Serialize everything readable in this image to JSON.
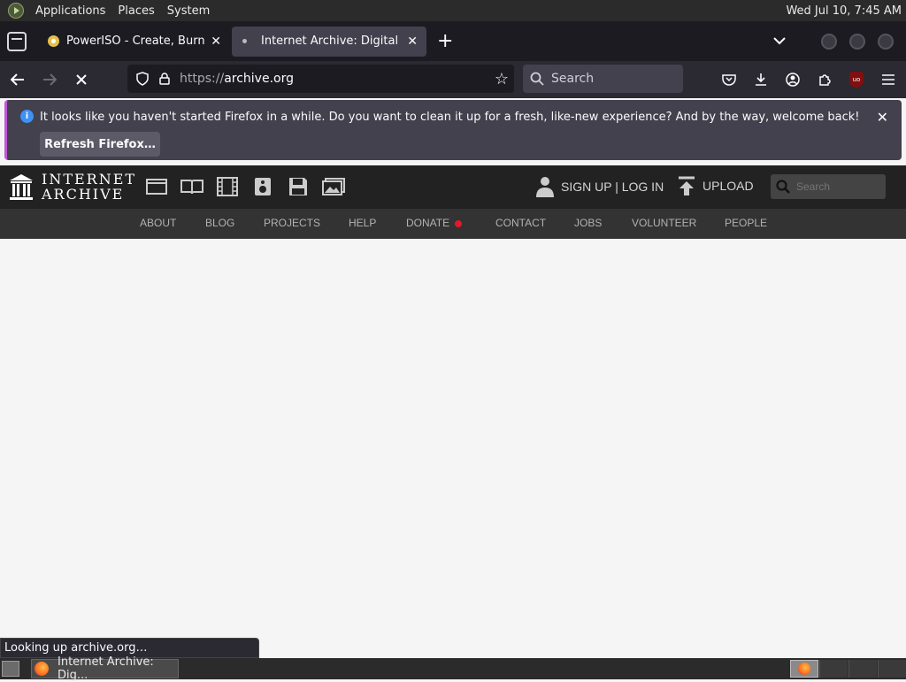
{
  "top_panel": {
    "menus": [
      "Applications",
      "Places",
      "System"
    ],
    "clock": "Wed Jul 10,  7:45 AM"
  },
  "tabs": [
    {
      "title": "PowerISO - Create, Burn, M",
      "active": false
    },
    {
      "title": "Internet Archive: Digital Libr",
      "active": true
    }
  ],
  "nav": {
    "url_proto": "https://",
    "url_host": "archive.org",
    "search_placeholder": "Search"
  },
  "notification": {
    "message": "It looks like you haven't started Firefox in a while. Do you want to clean it up for a fresh, like-new experience? And by the way, welcome back!",
    "button": "Refresh Firefox…"
  },
  "ia": {
    "wordmark_line1": "INTERNET",
    "wordmark_line2": "ARCHIVE",
    "media_icons": [
      "web-icon",
      "texts-icon",
      "video-icon",
      "audio-icon",
      "software-icon",
      "images-icon"
    ],
    "signup": "SIGN UP | LOG IN",
    "upload": "UPLOAD",
    "search_placeholder": "Search",
    "subnav": [
      "ABOUT",
      "BLOG",
      "PROJECTS",
      "HELP",
      "DONATE",
      "CONTACT",
      "JOBS",
      "VOLUNTEER",
      "PEOPLE"
    ],
    "donate_dot_color": "#e8162a"
  },
  "status": "Looking up archive.org…",
  "taskbar": {
    "window_title": "Internet Archive: Dig..."
  }
}
